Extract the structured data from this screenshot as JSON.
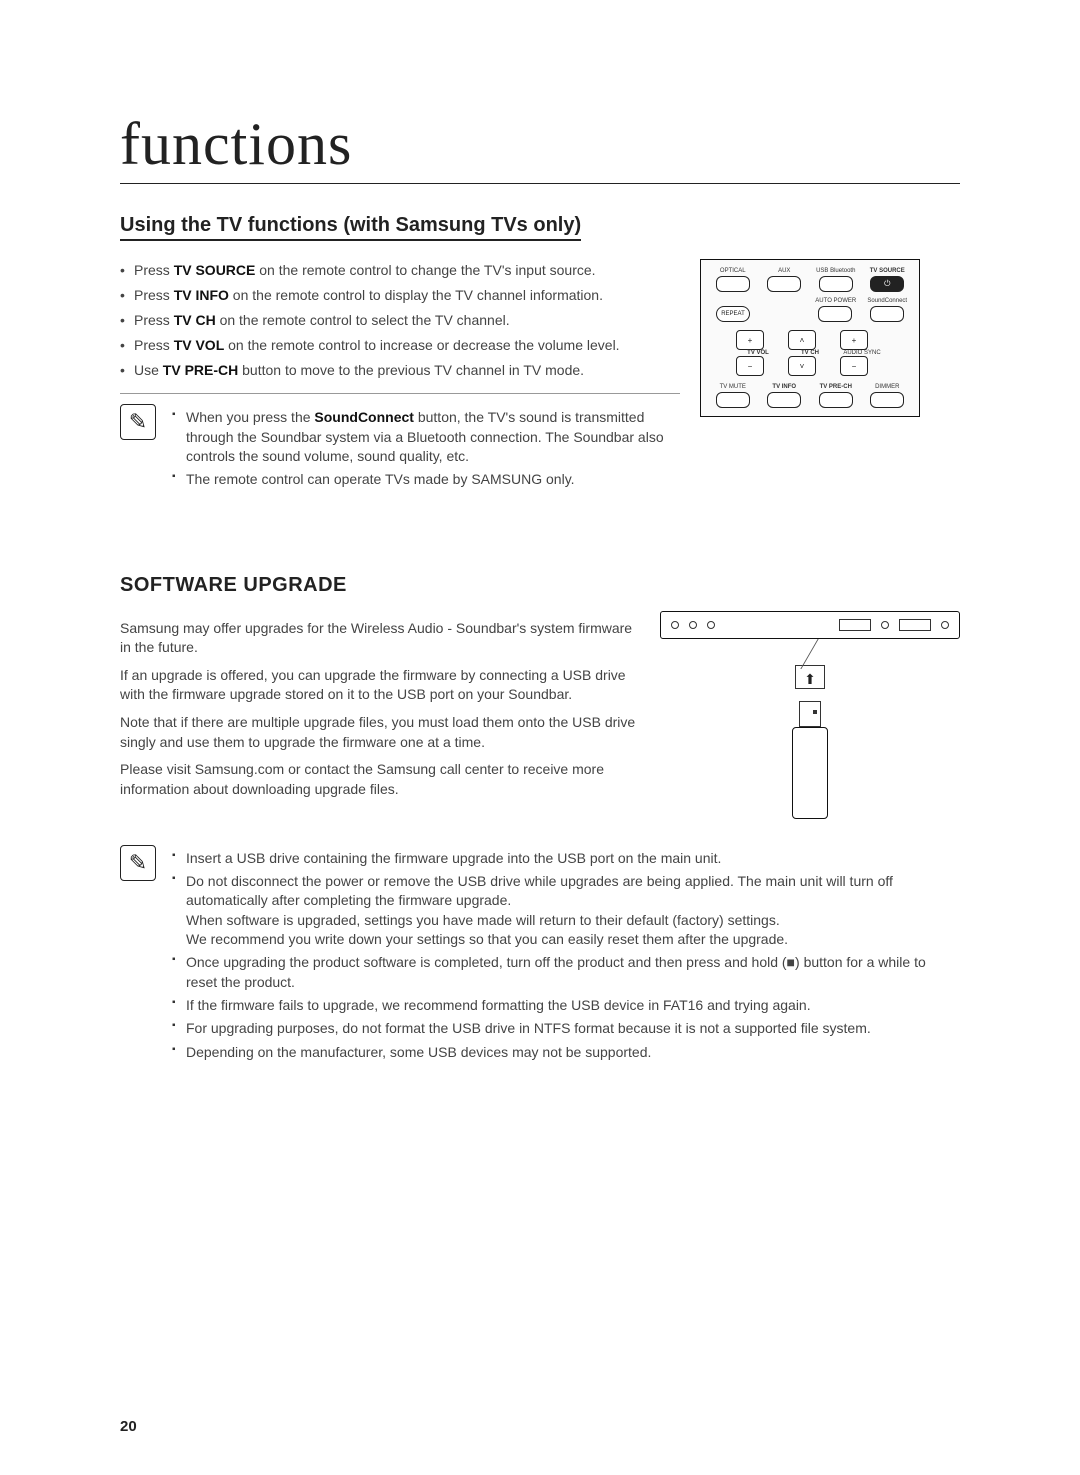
{
  "page": {
    "title": "functions",
    "number": "20"
  },
  "tv_section": {
    "heading": "Using the TV functions (with Samsung TVs only)",
    "bullets": [
      {
        "pre": "Press ",
        "bold": "TV SOURCE",
        "post": " on the remote control to change the TV's input source."
      },
      {
        "pre": "Press ",
        "bold": "TV INFO",
        "post": " on the remote control to display the TV channel information."
      },
      {
        "pre": "Press ",
        "bold": "TV CH",
        "post": " on the remote control to select the TV channel."
      },
      {
        "pre": "Press ",
        "bold": "TV VOL",
        "post": " on the remote control to increase or decrease the volume level."
      },
      {
        "pre": "Use ",
        "bold": "TV PRE-CH",
        "post": " button to move to the previous TV channel in TV mode."
      }
    ],
    "notes": [
      {
        "pre": "When you press the ",
        "bold": "SoundConnect",
        "post": " button, the TV's sound is transmitted through the Soundbar system via a Bluetooth connection. The Soundbar also controls the sound volume, sound quality, etc."
      },
      {
        "pre": "",
        "bold": "",
        "post": "The remote control can operate TVs made by SAMSUNG only."
      }
    ]
  },
  "remote": {
    "row1_labels": [
      "OPTICAL",
      "AUX",
      "USB Bluetooth",
      "TV SOURCE"
    ],
    "row2_labels": [
      "",
      "",
      "AUTO POWER",
      "SoundConnect"
    ],
    "row2_btn": "REPEAT",
    "row3": {
      "left": {
        "top": "+",
        "lbl": "TV VOL",
        "bot": "−"
      },
      "mid": {
        "top": "˄",
        "lbl": "TV CH",
        "bot": "˅"
      },
      "right": {
        "top": "+",
        "lbl": "AUDIO SYNC",
        "bot": "−"
      }
    },
    "row4_labels": [
      "TV MUTE",
      "TV INFO",
      "TV PRE-CH",
      "DIMMER"
    ]
  },
  "software": {
    "heading": "SOFTWARE UPGRADE",
    "paras": [
      "Samsung may offer upgrades for the Wireless Audio - Soundbar's system firmware in the future.",
      "If an upgrade is offered, you can upgrade the firmware by connecting a USB drive with the firmware upgrade stored on it to the USB port on your Soundbar.",
      "Note that if there are multiple upgrade files, you must load them onto the USB drive singly and use them to upgrade the firmware one at a time.",
      "Please visit Samsung.com or contact the Samsung call center to receive more information about downloading upgrade files."
    ],
    "notes": [
      "Insert a USB drive containing the firmware upgrade into the USB port on the main unit.",
      "Do not disconnect the power or remove the USB drive while upgrades are being applied. The main unit will turn off automatically after completing the firmware upgrade.\nWhen software is upgraded, settings you have made will return to their default (factory) settings.\nWe recommend you write down your settings so that you can easily reset them after the upgrade.",
      "Once upgrading the product software is completed, turn off the product and then press and hold (■) button for a while to reset the product.",
      "If the firmware fails to upgrade, we recommend formatting the USB device in FAT16 and trying again.",
      "For upgrading purposes, do not format the USB drive in NTFS format because it is not a supported file system.",
      "Depending on the manufacturer, some USB devices may not be supported."
    ]
  }
}
